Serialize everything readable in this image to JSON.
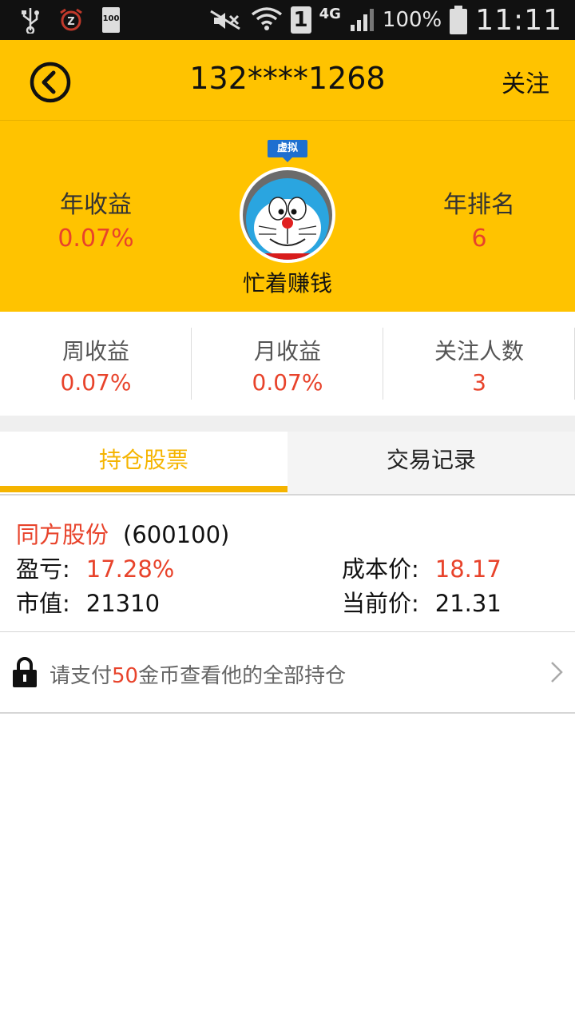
{
  "status_bar": {
    "battery_small": "100",
    "battery_percent": "100%",
    "sim": "1",
    "network": "4G",
    "time": "11:11"
  },
  "header": {
    "title": "132****1268",
    "follow_label": "关注"
  },
  "profile": {
    "annual_return_label": "年收益",
    "annual_return_value": "0.07%",
    "annual_rank_label": "年排名",
    "annual_rank_value": "6",
    "badge": "虚拟",
    "nickname": "忙着赚钱"
  },
  "stats": [
    {
      "label": "周收益",
      "value": "0.07%"
    },
    {
      "label": "月收益",
      "value": "0.07%"
    },
    {
      "label": "关注人数",
      "value": "3"
    }
  ],
  "tabs": [
    {
      "label": "持仓股票",
      "active": true
    },
    {
      "label": "交易记录",
      "active": false
    }
  ],
  "holding": {
    "name": "同方股份",
    "code": "(600100)",
    "pl_label": "盈亏:",
    "pl_value": "17.28%",
    "cost_label": "成本价:",
    "cost_value": "18.17",
    "mv_label": "市值:",
    "mv_value": "21310",
    "price_label": "当前价:",
    "price_value": "21.31"
  },
  "locked": {
    "prefix": "请支付",
    "coins": "50",
    "suffix": "金币查看他的全部持仓"
  },
  "colors": {
    "brand_yellow": "#ffc300",
    "accent_red": "#e8432b",
    "tab_active": "#f5b400",
    "badge_blue": "#1e6fd0"
  }
}
